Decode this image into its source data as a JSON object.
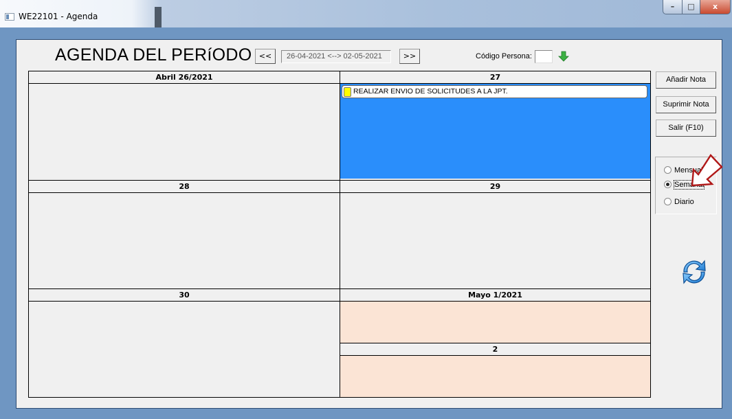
{
  "window": {
    "title": "WE22101 - Agenda",
    "controls": {
      "minimize": "–",
      "maximize": "□",
      "close": "x"
    }
  },
  "header": {
    "title": "AGENDA DEL PERíODO",
    "prev_label": "<<",
    "period": "26-04-2021 <--> 02-05-2021",
    "next_label": ">>",
    "codigo_label": "Código Persona:",
    "codigo_value": ""
  },
  "calendar": {
    "days": [
      {
        "label": "Abril 26/2021"
      },
      {
        "label": "27"
      },
      {
        "label": "28"
      },
      {
        "label": "29"
      },
      {
        "label": "30"
      },
      {
        "label": "Mayo 1/2021"
      },
      {
        "label": "2"
      }
    ],
    "notes": [
      {
        "day": "27",
        "text": "REALIZAR ENVIO DE SOLICITUDES A LA JPT."
      }
    ]
  },
  "sidebar": {
    "add_note": "Añadir Nota",
    "delete_note": "Suprimir Nota",
    "exit": "Salir (F10)",
    "view_options": [
      {
        "label": "Mensual",
        "selected": false
      },
      {
        "label": "Semanal",
        "selected": true
      },
      {
        "label": "Diario",
        "selected": false
      }
    ]
  },
  "colors": {
    "selected_day": "#2a8efb",
    "weekend_day": "#fbe4d5",
    "note_marker": "#ffff00",
    "annotation": "#b01818"
  },
  "icons": {
    "down_arrow": "green-down-arrow-icon",
    "refresh": "refresh-icon",
    "annotation": "red-outline-arrow-icon"
  }
}
